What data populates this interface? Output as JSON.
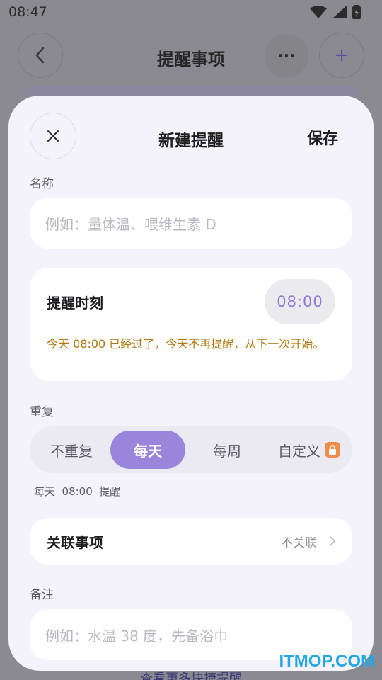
{
  "status_bar": {
    "time": "08:47"
  },
  "background": {
    "title": "提醒事项",
    "more_label": "···",
    "add_label": "+",
    "footer_link": "查看更多快捷提醒"
  },
  "sheet": {
    "title": "新建提醒",
    "save_label": "保存",
    "name": {
      "label": "名称",
      "placeholder": "例如：量体温、喂维生素 D"
    },
    "reminder_time": {
      "label": "提醒时刻",
      "value": "08:00",
      "warning": "今天 08:00 已经过了，今天不再提醒，从下一次开始。"
    },
    "repeat": {
      "label": "重复",
      "options": [
        "不重复",
        "每天",
        "每周",
        "自定义"
      ],
      "selected": "每天",
      "summary": "每天  08:00  提醒"
    },
    "related": {
      "label": "关联事项",
      "value": "不关联"
    },
    "note": {
      "label": "备注",
      "placeholder": "例如：水温 38 度，先备浴巾"
    }
  },
  "watermark": "ITMOP.COM",
  "colors": {
    "accent": "#9a85dd",
    "time_text": "#8f78d8",
    "warning": "#b0760a",
    "lock": "#ee8c49",
    "sheet_bg": "#f4f2fb"
  }
}
